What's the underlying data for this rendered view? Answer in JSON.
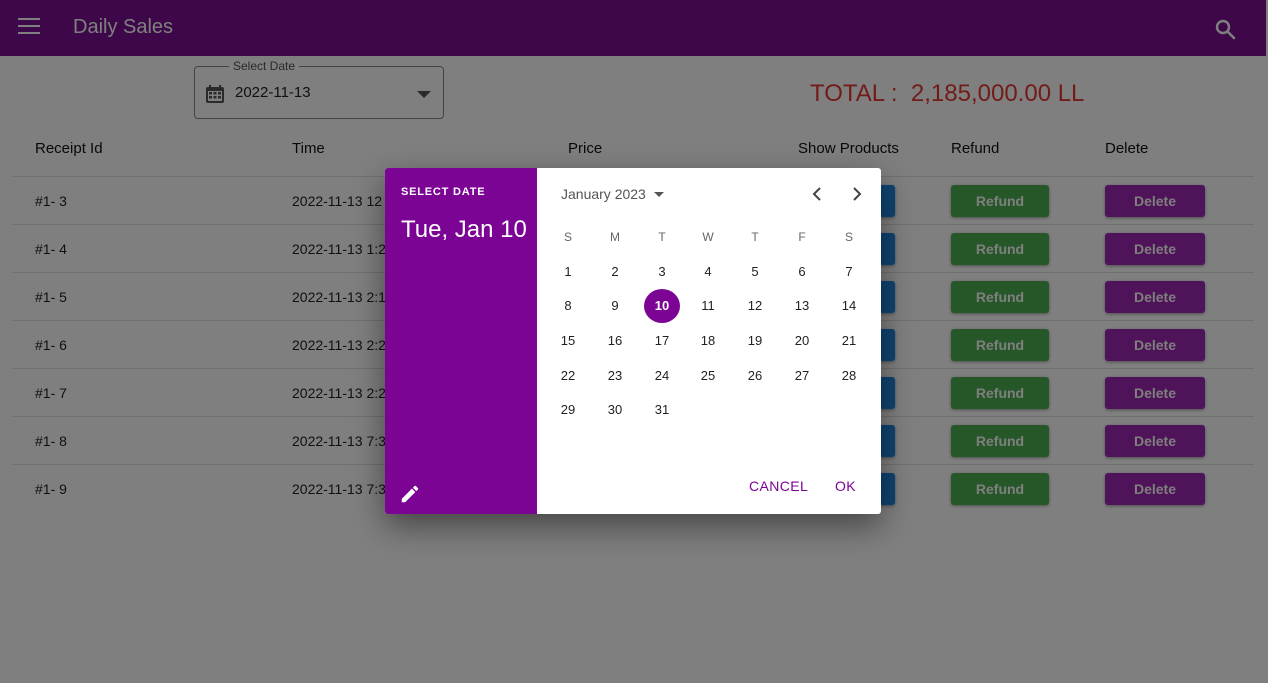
{
  "app_bar": {
    "title": "Daily Sales",
    "menu_icon": "menu-icon",
    "search_icon": "search-icon",
    "color": "#7b0f93"
  },
  "date_field": {
    "label": "Select Date",
    "value": "2022-11-13",
    "icon": "calendar-icon"
  },
  "total": {
    "text": "TOTAL :  2,185,000.00 LL",
    "color": "#e53935"
  },
  "table": {
    "headers": [
      "Receipt Id",
      "Time",
      "Price",
      "Show Products",
      "Refund",
      "Delete"
    ],
    "refund_label": "Refund",
    "delete_label": "Delete",
    "rows": [
      {
        "id": "#1- 3",
        "time": "2022-11-13  12"
      },
      {
        "id": "#1- 4",
        "time": "2022-11-13  1:2"
      },
      {
        "id": "#1- 5",
        "time": "2022-11-13  2:1"
      },
      {
        "id": "#1- 6",
        "time": "2022-11-13  2:2"
      },
      {
        "id": "#1- 7",
        "time": "2022-11-13  2:2"
      },
      {
        "id": "#1- 8",
        "time": "2022-11-13  7:3"
      },
      {
        "id": "#1- 9",
        "time": "2022-11-13  7:3"
      }
    ],
    "colors": {
      "show": "#1e88e5",
      "refund": "#4caf50",
      "delete": "#9c27b0"
    }
  },
  "date_picker": {
    "header_label": "SELECT DATE",
    "selected_text": "Tue, Jan 10",
    "month_label": "January 2023",
    "weekdays": [
      "S",
      "M",
      "T",
      "W",
      "T",
      "F",
      "S"
    ],
    "first_weekday_index": 0,
    "days_in_month": 31,
    "selected_day": 10,
    "cancel_label": "CANCEL",
    "ok_label": "OK",
    "accent": "#7b0494"
  }
}
